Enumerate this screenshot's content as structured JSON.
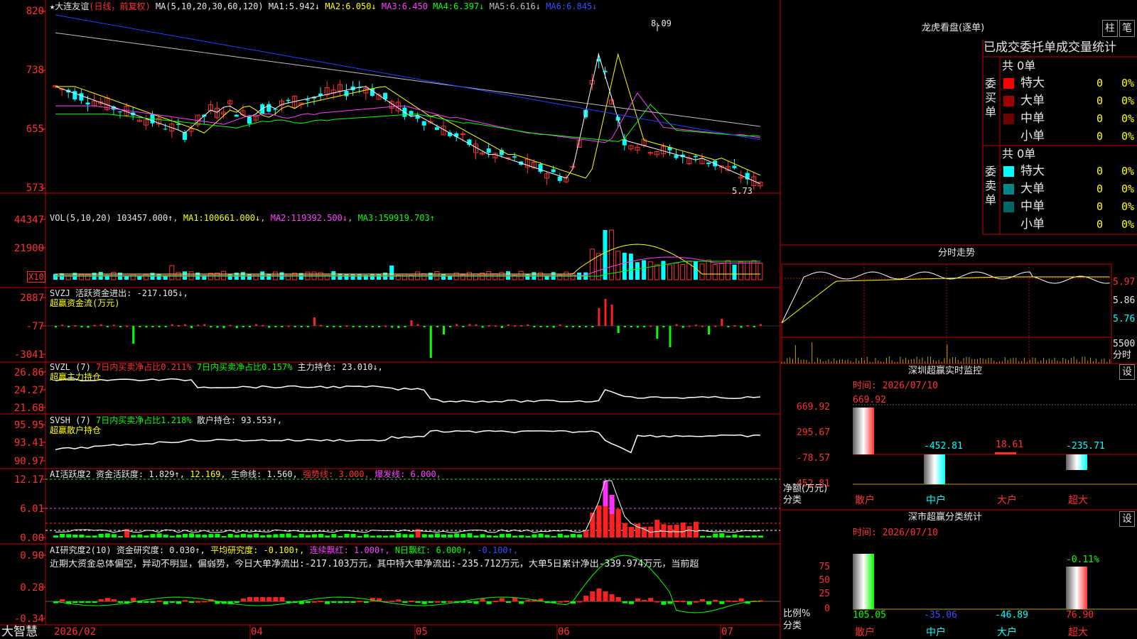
{
  "app": {
    "brand": "大智慧"
  },
  "main": {
    "stock": "大连友谊",
    "period": "(日线，前复权)",
    "ma_title": "MA(5,10,20,30,60,120)",
    "ma": [
      {
        "k": "MA1:",
        "v": "5.942↓"
      },
      {
        "k": "MA2:",
        "v": "6.050↓"
      },
      {
        "k": "MA3:",
        "v": "6.450"
      },
      {
        "k": "MA4:",
        "v": "6.397↓"
      },
      {
        "k": "MA5:",
        "v": "6.616↓"
      },
      {
        "k": "MA6:",
        "v": "6.845↓"
      }
    ],
    "y": [
      "820",
      "738",
      "655",
      "573"
    ],
    "hi": "8.09",
    "lo": "5.73"
  },
  "vol": {
    "title": "VOL(5,10,20)",
    "val": "103457.000↑",
    "ma": [
      {
        "k": "MA1:",
        "v": "100661.000↓"
      },
      {
        "k": "MA2:",
        "v": "119392.500↓"
      },
      {
        "k": "MA3:",
        "v": "159919.703↑"
      }
    ],
    "y": [
      "44347",
      "21900"
    ],
    "unit": "X10"
  },
  "svzj": {
    "l1": "SVZJ  活跃资金进出: -217.105↓,",
    "l2": "超赢资金流(万元)",
    "y": [
      "2887",
      "-77",
      "-3041"
    ]
  },
  "svzl": {
    "l1a": "SVZL (7)",
    "l1b": "7日内买卖净占比0.211%",
    "l1c": "7日内买卖净占比0.157%",
    "l1d": "主力持仓: 23.010↓,",
    "l2": "超赢主力持仓",
    "y": [
      "26.86",
      "24.27",
      "21.68"
    ]
  },
  "svsh": {
    "l1a": "SVSH (7)",
    "l1b": "7日内买卖净占比1.218%",
    "l1c": "散户持仓: 93.553↑,",
    "l2": "超赢散户持仓",
    "y": [
      "95.95",
      "93.41",
      "90.97"
    ]
  },
  "ai": {
    "a": "AI活跃度2",
    "b": "资金活跃度: 1.829↑,",
    "c": "12.169,",
    "d": "生命线: 1.560,",
    "e": "强势线: 3.000,",
    "f": "爆发线: 6.000,",
    "y": [
      "12.17",
      "6.01",
      "0.00"
    ]
  },
  "air": {
    "a": "AI研究度2(10)",
    "b": "资金研究度: 0.030↑,",
    "c": "平均研究度: -0.100↑,",
    "d": "连续飘红: 1.000↑,",
    "e": "N日飘红: 6.000↑,",
    "f": "-0.100↑,",
    "desc": "近期大资金总体偏空，异动不明显，偏弱势，今日大单净流出:-217.103万元，其中特大单净流出:-235.712万元，大单5日累计净出-339.974万元，当前超",
    "y": [
      "0.90",
      "0.28",
      "-0.34"
    ]
  },
  "dates": [
    "2026/02",
    "04",
    "05",
    "06",
    "07"
  ],
  "right": {
    "tiger_title": "龙虎看盘(逐单)",
    "tab_zhu": "柱",
    "tab_bi": "笔",
    "table_title": "已成交委托单成交量统计",
    "buy": {
      "label": "委买单",
      "total": "共 0单",
      "rows": [
        {
          "n": "特大",
          "v": "0",
          "p": "0%",
          "c": "#ff0000"
        },
        {
          "n": "大单",
          "v": "0",
          "p": "0%",
          "c": "#a00000"
        },
        {
          "n": "中单",
          "v": "0",
          "p": "0%",
          "c": "#700000"
        },
        {
          "n": "小单",
          "v": "0",
          "p": "0%",
          "c": "#000000"
        }
      ]
    },
    "sell": {
      "label": "委卖单",
      "total": "共 0单",
      "rows": [
        {
          "n": "特大",
          "v": "0",
          "p": "0%",
          "c": "#00ffff"
        },
        {
          "n": "大单",
          "v": "0",
          "p": "0%",
          "c": "#008888"
        },
        {
          "n": "中单",
          "v": "0",
          "p": "0%",
          "c": "#006666"
        },
        {
          "n": "小单",
          "v": "0",
          "p": "0%",
          "c": "#000000"
        }
      ]
    },
    "intraday": {
      "title": "分时走势",
      "y": [
        "5.97",
        "5.86",
        "5.76"
      ],
      "vol": "5500",
      "vlab": "分时"
    },
    "sz": {
      "title": "深圳超赢实时监控",
      "set": "设",
      "time": "时间: 2026/07/10",
      "y": [
        "669.92",
        "295.67",
        "-78.57",
        "-452.81"
      ],
      "vals": [
        "669.92",
        "-452.81",
        "18.61",
        "-235.71"
      ],
      "cats": [
        "散户",
        "中户",
        "大户",
        "超大"
      ],
      "ylab1": "净额(万元)",
      "ylab2": "分类"
    },
    "szc": {
      "title": "深市超赢分类统计",
      "set": "设",
      "time": "时间: 2026/07/10",
      "y": [
        "75",
        "50",
        "25",
        "0"
      ],
      "top": "-0.11%",
      "vals": [
        "105.05",
        "-35.06",
        "-46.89",
        "76.90"
      ],
      "cats": [
        "散户",
        "中户",
        "大户",
        "超大"
      ],
      "ylab1": "比例%",
      "ylab2": "分类"
    }
  }
}
